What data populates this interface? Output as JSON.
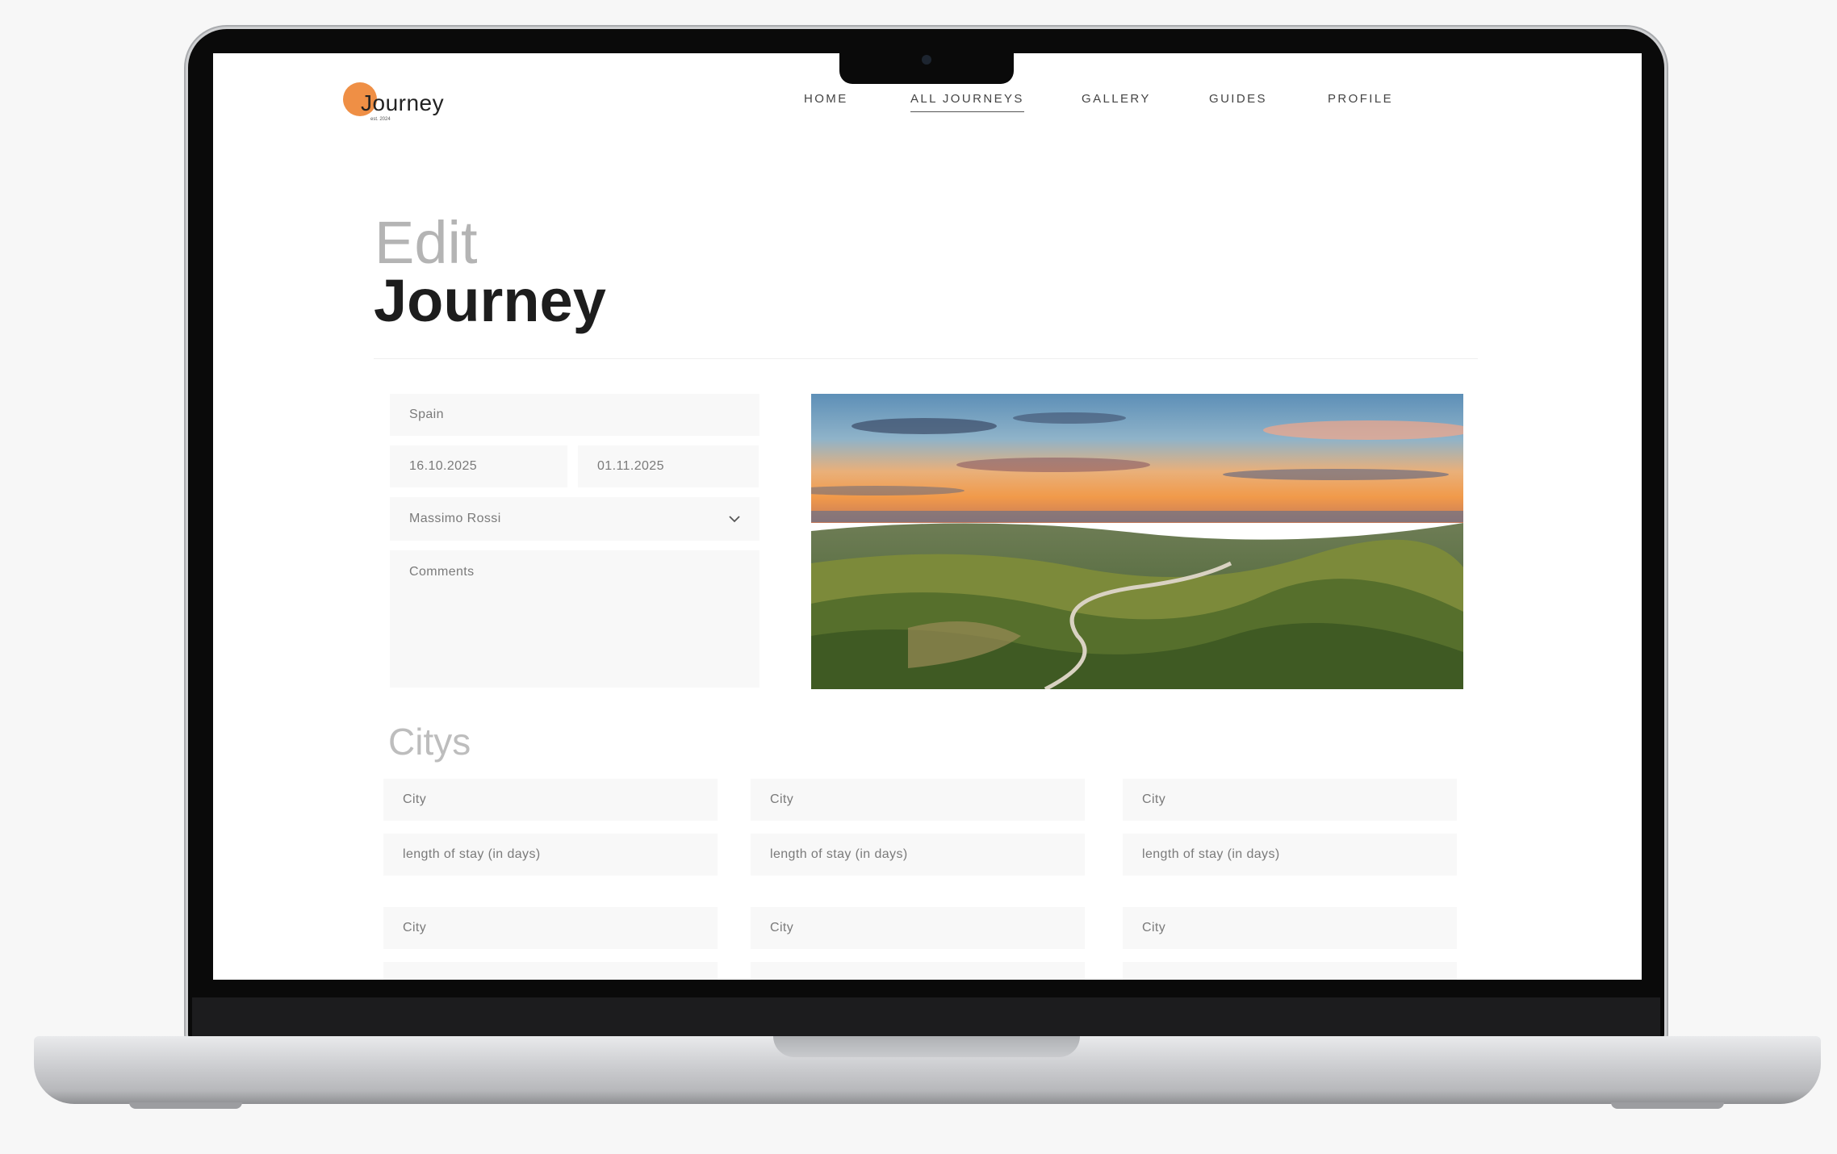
{
  "header": {
    "logo_text": "Journey",
    "logo_sub": "est. 2024",
    "nav": [
      {
        "label": "HOME",
        "active": false
      },
      {
        "label": "ALL JOURNEYS",
        "active": true
      },
      {
        "label": "GALLERY",
        "active": false
      },
      {
        "label": "GUIDES",
        "active": false
      },
      {
        "label": "PROFILE",
        "active": false
      }
    ]
  },
  "page": {
    "title_light": "Edit",
    "title_bold": "Journey"
  },
  "form": {
    "country": "Spain",
    "start_date": "16.10.2025",
    "end_date": "01.11.2025",
    "guide": "Massimo Rossi",
    "comments_placeholder": "Comments"
  },
  "cities": {
    "section_title": "Citys",
    "city_placeholder": "City",
    "stay_placeholder": "length of stay (in days)"
  },
  "colors": {
    "accent": "#ef8f45",
    "field_bg": "#f8f8f8",
    "text_dark": "#1d1d1d",
    "text_muted": "#b4b4b4"
  }
}
